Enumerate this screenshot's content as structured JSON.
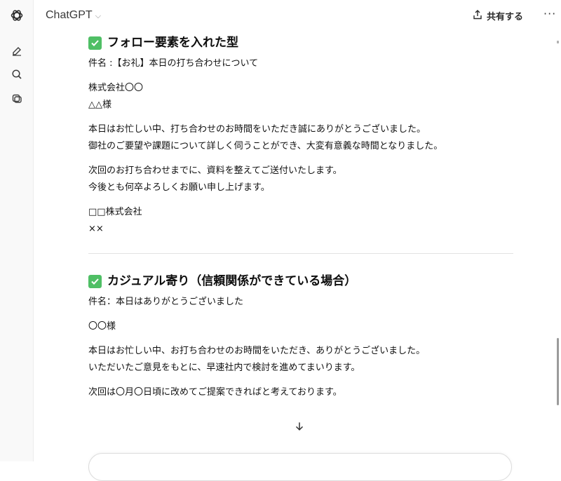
{
  "app": {
    "model_name": "ChatGPT",
    "share_label": "共有する",
    "more_label": "···"
  },
  "icons": {
    "logo": "openai-logo-icon",
    "new_chat": "edit-icon",
    "search": "search-icon",
    "library": "library-icon",
    "share": "share-icon",
    "chevron": "chevron-down-icon",
    "scroll_down": "arrow-down-icon"
  },
  "colors": {
    "check": "#4fbf65",
    "rail": "#f9f9f9"
  },
  "section1": {
    "title": "フォロー要素を入れた型",
    "subject": "件名 :【お礼】本日の打ち合わせについて",
    "company": "株式会社〇〇",
    "recipient": "△△様",
    "body1_line1": "本日はお忙しい中、打ち合わせのお時間をいただき誠にありがとうございました。",
    "body1_line2": "御社のご要望や課題について詳しく伺うことができ、大変有意義な時間となりました。",
    "body2_line1": "次回のお打ち合わせまでに、資料を整えてご送付いたします。",
    "body2_line2": "今後とも何卒よろしくお願い申し上げます。",
    "sender_company": "□□株式会社",
    "sender_name": "××"
  },
  "section2": {
    "title": "カジュアル寄り（信頼関係ができている場合）",
    "subject": "件名：本日はありがとうございました",
    "recipient": "〇〇様",
    "body1_line1": "本日はお忙しい中、お打ち合わせのお時間をいただき、ありがとうございました。",
    "body1_line2": "いただいたご意見をもとに、早速社内で検討を進めてまいります。",
    "body2_line1": "次回は〇月〇日頃に改めてご提案できればと考えております。"
  }
}
